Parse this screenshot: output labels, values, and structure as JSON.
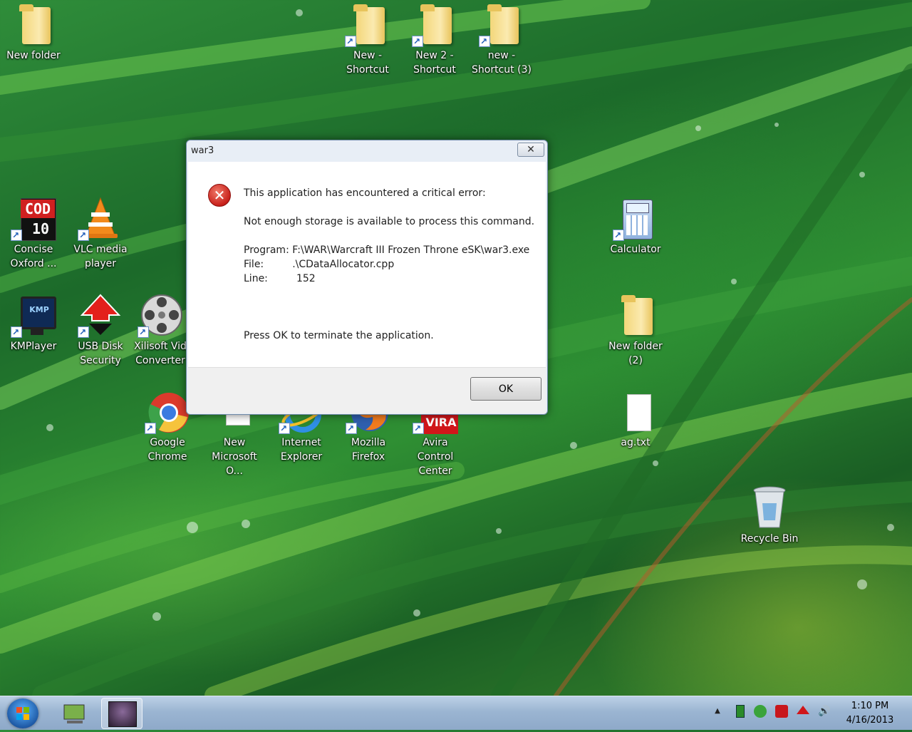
{
  "desktop": {
    "icons": [
      {
        "label": "New folder"
      },
      {
        "label": "New -\nShortcut"
      },
      {
        "label": "New 2 -\nShortcut"
      },
      {
        "label": "new -\nShortcut (3)"
      },
      {
        "label": "Concise\nOxford ..."
      },
      {
        "label": "VLC media\nplayer"
      },
      {
        "label": "KMPlayer"
      },
      {
        "label": "USB Disk\nSecurity"
      },
      {
        "label": "Xilisoft Vid\nConverter"
      },
      {
        "label": "Google\nChrome"
      },
      {
        "label": "New\nMicrosoft O..."
      },
      {
        "label": "Internet\nExplorer"
      },
      {
        "label": "Mozilla\nFirefox"
      },
      {
        "label": "Avira Control\nCenter"
      },
      {
        "label": "Calculator"
      },
      {
        "label": "New folder\n(2)"
      },
      {
        "label": "ag.txt"
      },
      {
        "label": "Recycle Bin"
      }
    ],
    "icon_text": {
      "cod": "COD",
      "cod_num": "10",
      "kmp": "KMP",
      "avira": "VIRA"
    }
  },
  "dialog": {
    "title": "war3",
    "close_symbol": "✕",
    "error_symbol": "✕",
    "line1": "This application has encountered a critical error:",
    "line2": "Not enough storage is available to process this command.",
    "program": "Program: F:\\WAR\\Warcraft III Frozen Throne eSK\\war3.exe",
    "file": "File:         .\\CDataAllocator.cpp",
    "line": "Line:         152",
    "press": "Press OK to terminate the application.",
    "ok_label": "OK"
  },
  "taskbar": {
    "clock_time": "1:10 PM",
    "clock_date": "4/16/2013",
    "tray_arrow": "▲",
    "volume_symbol": "🔊"
  }
}
